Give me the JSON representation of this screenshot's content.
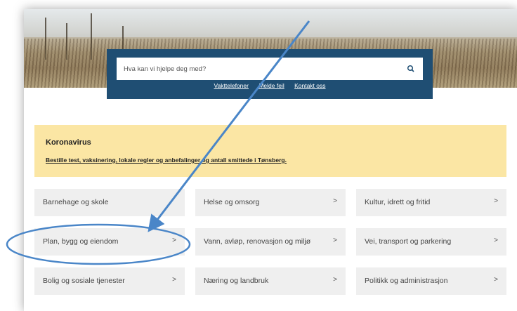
{
  "search": {
    "placeholder": "Hva kan vi hjelpe deg med?",
    "icon": "search-icon"
  },
  "quick_links": [
    "Vakttelefoner",
    "Melde feil",
    "Kontakt oss"
  ],
  "alert": {
    "title": "Koronavirus",
    "link": "Bestille test, vaksinering, lokale regler og anbefalinger og antall smittede i Tønsberg.",
    "background": "#fbe6a4"
  },
  "categories": [
    {
      "label": "Barnehage og skole",
      "chevron": ">"
    },
    {
      "label": "Helse og omsorg",
      "chevron": ">"
    },
    {
      "label": "Kultur, idrett og fritid",
      "chevron": ">"
    },
    {
      "label": "Plan, bygg og eiendom",
      "chevron": ">"
    },
    {
      "label": "Vann, avløp, renovasjon og miljø",
      "chevron": ">"
    },
    {
      "label": "Vei, transport og parkering",
      "chevron": ">"
    },
    {
      "label": "Bolig og sosiale tjenester",
      "chevron": ">"
    },
    {
      "label": "Næring og landbruk",
      "chevron": ">"
    },
    {
      "label": "Politikk og administrasjon",
      "chevron": ">"
    }
  ],
  "colors": {
    "panel": "#1f4e73",
    "annotation": "#4a86c8"
  }
}
